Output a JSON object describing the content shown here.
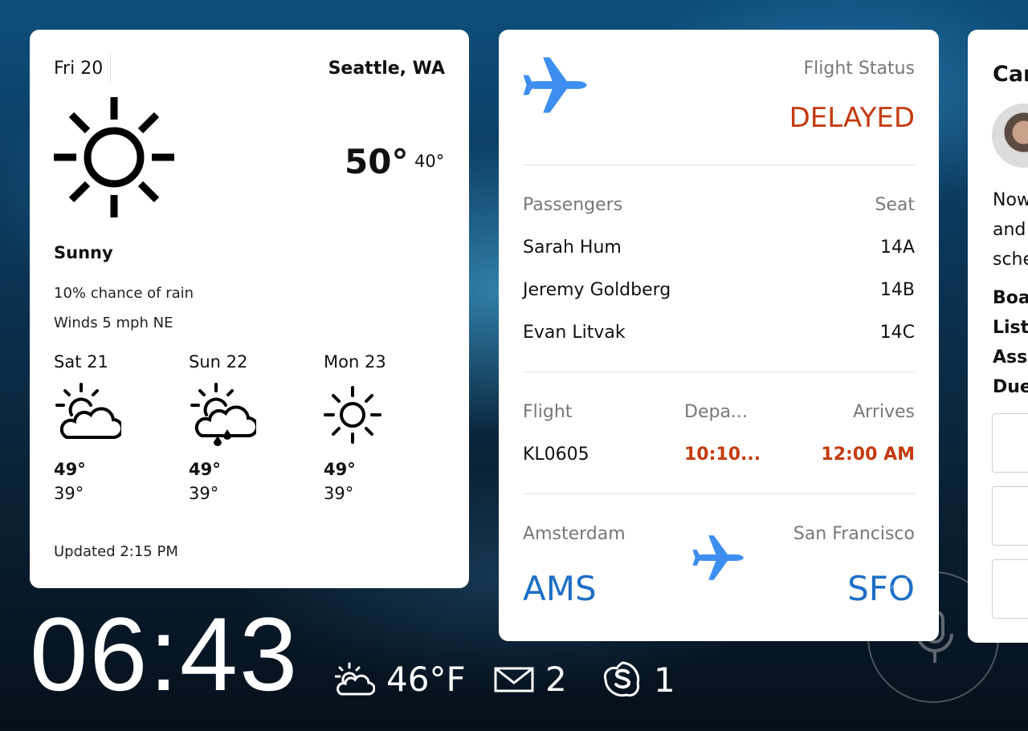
{
  "weather": {
    "date": "Fri 20",
    "city": "Seattle, WA",
    "high": "50°",
    "low": "40°",
    "condition": "Sunny",
    "rain": "10% chance of rain",
    "wind": "Winds 5 mph NE",
    "forecast": [
      {
        "day": "Sat 21",
        "icon": "partly-cloudy-icon",
        "high": "49°",
        "low": "39°"
      },
      {
        "day": "Sun 22",
        "icon": "partly-cloudy-rain-icon",
        "high": "49°",
        "low": "39°"
      },
      {
        "day": "Mon 23",
        "icon": "sun-icon",
        "high": "49°",
        "low": "39°"
      }
    ],
    "updated": "Updated 2:15 PM"
  },
  "flight": {
    "status_label": "Flight Status",
    "status_value": "DELAYED",
    "passengers_label": "Passengers",
    "seat_label": "Seat",
    "passengers": [
      {
        "name": "Sarah Hum",
        "seat": "14A"
      },
      {
        "name": "Jeremy Goldberg",
        "seat": "14B"
      },
      {
        "name": "Evan Litvak",
        "seat": "14C"
      }
    ],
    "flight_label": "Flight",
    "departs_label": "Depa...",
    "arrives_label": "Arrives",
    "flight_number": "KL0605",
    "departs_time": "10:10...",
    "arrives_time": "12:00 AM",
    "origin_city": "Amsterdam",
    "dest_city": "San Francisco",
    "origin_code": "AMS",
    "dest_code": "SFO",
    "accent_color": "#c43b10",
    "code_color": "#1e6fc6"
  },
  "card3": {
    "title": "Car",
    "text_lines": [
      "Now",
      "and",
      "sche"
    ],
    "bold_lines": [
      "Boa",
      "List:",
      "Assi",
      "Due"
    ]
  },
  "status_bar": {
    "time": "06:43",
    "weather": "46°F",
    "mail_count": "2",
    "skype_count": "1"
  }
}
